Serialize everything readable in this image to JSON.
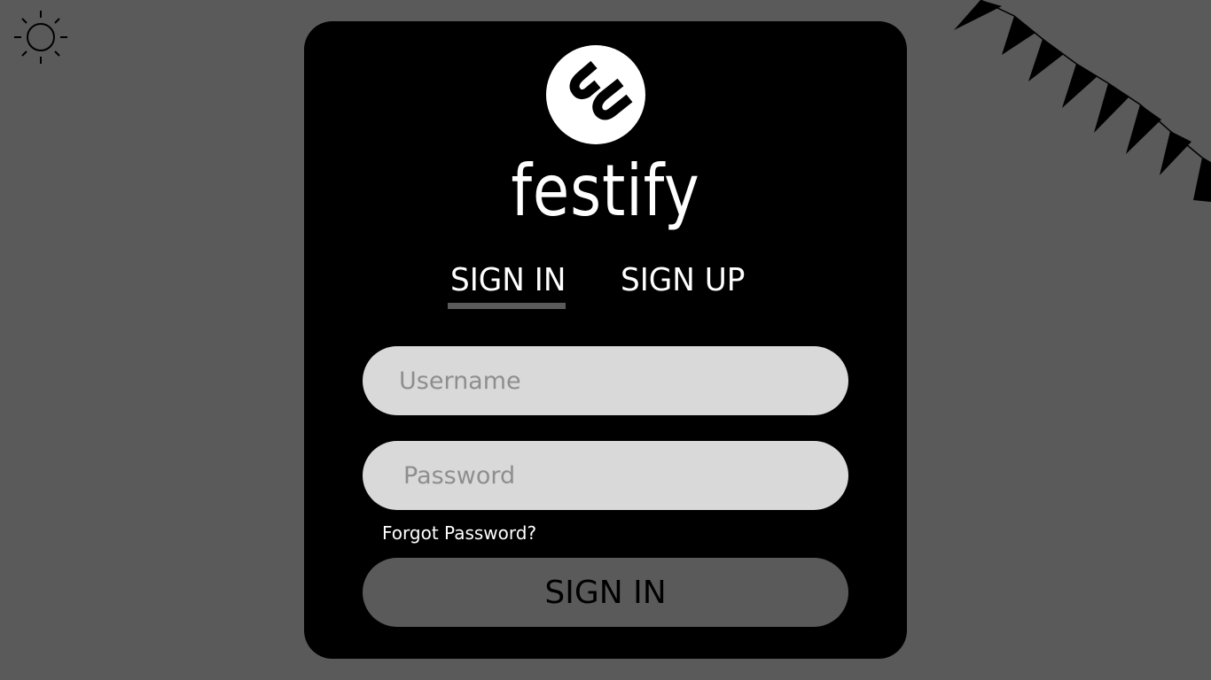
{
  "theme_toggle": {
    "icon": "sun-icon"
  },
  "decoration": {
    "icon": "bunting-flags-icon"
  },
  "brand": {
    "logo_icon": "festify-logo-icon",
    "name": "festify"
  },
  "tabs": [
    {
      "label": "SIGN IN",
      "active": true
    },
    {
      "label": "SIGN UP",
      "active": false
    }
  ],
  "form": {
    "username": {
      "placeholder": "Username",
      "value": ""
    },
    "password": {
      "placeholder": "Password",
      "value": ""
    },
    "forgot_password_label": "Forgot Password?",
    "submit_label": "SIGN IN"
  },
  "colors": {
    "page_background": "#5a5a5a",
    "card_background": "#000000",
    "field_background": "#d9d9d9",
    "placeholder_text": "#8e8e8e",
    "button_background": "#5a5a5a",
    "active_tab_indicator": "#5a5a5a",
    "text_on_card": "#ffffff"
  }
}
